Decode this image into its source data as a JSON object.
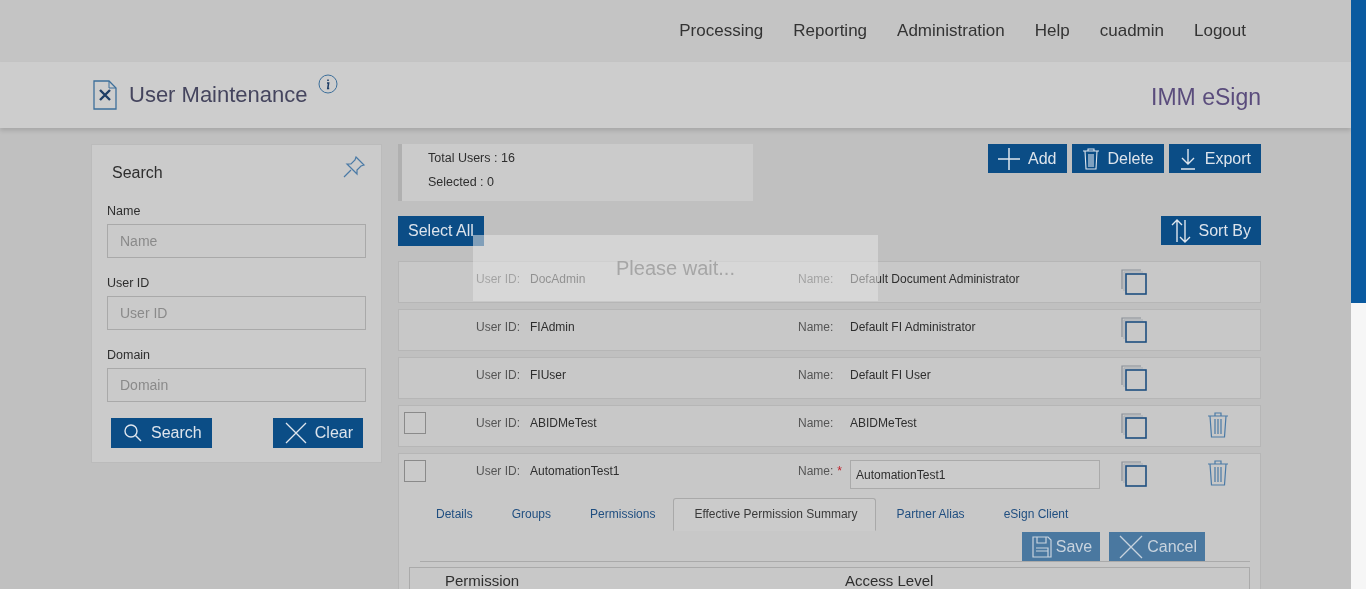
{
  "nav": {
    "items": [
      "Processing",
      "Reporting",
      "Administration",
      "Help",
      "cuadmin",
      "Logout"
    ]
  },
  "header": {
    "title": "User Maintenance",
    "brand": "IMM eSign"
  },
  "search_panel": {
    "title": "Search",
    "fields": [
      {
        "label": "Name",
        "placeholder": "Name"
      },
      {
        "label": "User ID",
        "placeholder": "User ID"
      },
      {
        "label": "Domain",
        "placeholder": "Domain"
      }
    ],
    "buttons": [
      {
        "label": "Search",
        "kind": "search"
      },
      {
        "label": "Clear",
        "kind": "clear"
      }
    ]
  },
  "summary": {
    "total": "Total Users : 16",
    "selected": "Selected : 0"
  },
  "toolbar": [
    {
      "label": "Add",
      "kind": "add"
    },
    {
      "label": "Delete",
      "kind": "delete"
    },
    {
      "label": "Export",
      "kind": "export"
    }
  ],
  "select_all": "Select All",
  "sort_by": "Sort By",
  "users": [
    {
      "kind": "system",
      "user_id_label": "User ID:",
      "user_id": "DocAdmin",
      "name_label": "Name:",
      "name": "Default Document Administrator"
    },
    {
      "kind": "system",
      "user_id_label": "User ID:",
      "user_id": "FIAdmin",
      "name_label": "Name:",
      "name": "Default FI Administrator"
    },
    {
      "kind": "system",
      "user_id_label": "User ID:",
      "user_id": "FIUser",
      "name_label": "Name:",
      "name": "Default FI User"
    },
    {
      "kind": "user",
      "checked": false,
      "editing": false,
      "user_id_label": "User ID:",
      "user_id": "ABIDMeTest",
      "name_label": "Name:",
      "name": "ABIDMeTest"
    },
    {
      "kind": "user",
      "checked": false,
      "editing": true,
      "user_id_label": "User ID:",
      "user_id": "AutomationTest1",
      "name_label": "Name:",
      "required_mark": "*",
      "name": "AutomationTest1",
      "detail": {
        "tabs": [
          {
            "label": "Details",
            "selected": false
          },
          {
            "label": "Groups",
            "selected": false
          },
          {
            "label": "Permissions",
            "selected": false
          },
          {
            "label": "Effective Permission Summary",
            "selected": true
          },
          {
            "label": "Partner Alias",
            "selected": false
          },
          {
            "label": "eSign Client",
            "selected": false
          }
        ],
        "buttons": [
          {
            "label": "Save",
            "kind": "save",
            "disabled": true
          },
          {
            "label": "Cancel",
            "kind": "cancel",
            "disabled": true
          }
        ],
        "table": {
          "columns": [
            "Permission",
            "Access Level"
          ]
        }
      }
    }
  ],
  "loading": {
    "text": "Please wait..."
  }
}
